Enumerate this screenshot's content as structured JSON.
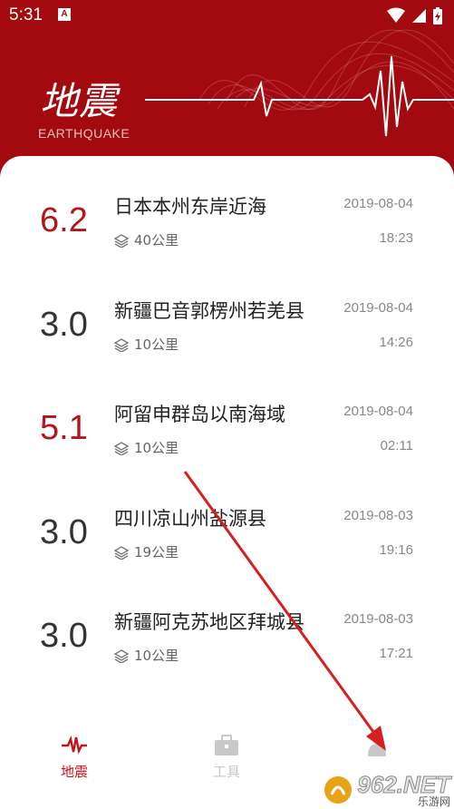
{
  "status_bar": {
    "time": "5:31",
    "notif_label": "A"
  },
  "header": {
    "title": "地震",
    "subtitle": "EARTHQUAKE"
  },
  "quakes": [
    {
      "magnitude": "6.2",
      "place": "日本本州东岸近海",
      "depth": "40公里",
      "date": "2019-08-04",
      "time": "18:23",
      "mag_color": "#b3151b"
    },
    {
      "magnitude": "3.0",
      "place": "新疆巴音郭楞州若羌县",
      "depth": "10公里",
      "date": "2019-08-04",
      "time": "14:26",
      "mag_color": "#333333"
    },
    {
      "magnitude": "5.1",
      "place": "阿留申群岛以南海域",
      "depth": "10公里",
      "date": "2019-08-04",
      "time": "02:11",
      "mag_color": "#b3151b"
    },
    {
      "magnitude": "3.0",
      "place": "四川凉山州盐源县",
      "depth": "19公里",
      "date": "2019-08-03",
      "time": "19:16",
      "mag_color": "#333333"
    },
    {
      "magnitude": "3.0",
      "place": "新疆阿克苏地区拜城县",
      "depth": "10公里",
      "date": "2019-08-03",
      "time": "17:21",
      "mag_color": "#333333"
    }
  ],
  "bottom_nav": {
    "earthquake_label": "地震",
    "tools_label": "工具"
  },
  "watermark": {
    "text": "962.NET",
    "sub": "乐游网"
  },
  "colors": {
    "accent": "#a30a10",
    "active_tab": "#c0151b",
    "inactive_tab": "#c8c8c8"
  }
}
